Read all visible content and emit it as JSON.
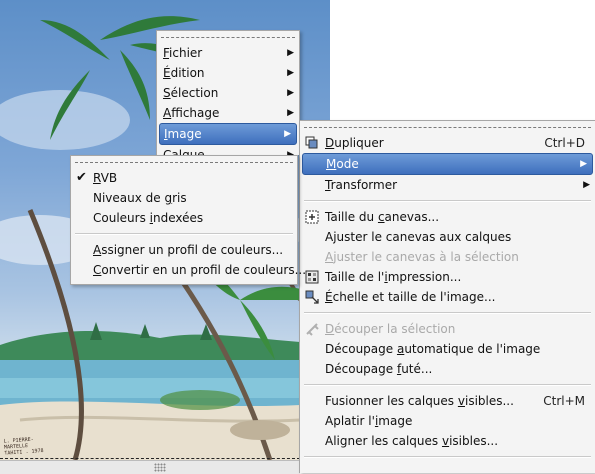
{
  "canvas": {
    "signature_lines": [
      "L. PIERRE-MARTELLE",
      "TAHITI . 1978"
    ]
  },
  "main_menu": {
    "items": [
      {
        "pre": "",
        "mn": "F",
        "post": "ichier",
        "name": "fichier"
      },
      {
        "pre": "",
        "mn": "É",
        "post": "dition",
        "name": "edition"
      },
      {
        "pre": "",
        "mn": "S",
        "post": "élection",
        "name": "selection"
      },
      {
        "pre": "",
        "mn": "A",
        "post": "ffichage",
        "name": "affichage"
      },
      {
        "pre": "",
        "mn": "I",
        "post": "mage",
        "name": "image"
      },
      {
        "pre": "",
        "mn": "C",
        "post": "alque",
        "name": "calque"
      }
    ],
    "active": "Image"
  },
  "image_menu": {
    "dupliquer": {
      "pre": "",
      "mn": "D",
      "post": "upliquer",
      "accel": "Ctrl+D"
    },
    "mode": {
      "pre": "",
      "mn": "M",
      "post": "ode"
    },
    "transformer": {
      "pre": "",
      "mn": "T",
      "post": "ransformer"
    },
    "taille_canevas": {
      "pre": "Taille du ",
      "mn": "c",
      "post": "anevas..."
    },
    "ajuster_calques": {
      "pre": "Ajuster le canevas aux calques",
      "mn": "",
      "post": ""
    },
    "ajuster_selection": {
      "pre": "",
      "mn": "A",
      "post": "juster le canevas à la sélection"
    },
    "taille_impression": {
      "pre": "Taille de l'",
      "mn": "i",
      "post": "mpression..."
    },
    "echelle": {
      "pre": "",
      "mn": "É",
      "post": "chelle et taille de l'image..."
    },
    "decouper_selection": {
      "pre": "",
      "mn": "D",
      "post": "écouper la sélection"
    },
    "decoupage_auto": {
      "pre": "Découpage ",
      "mn": "a",
      "post": "utomatique de l'image"
    },
    "decoupage_fute": {
      "pre": "Découpage ",
      "mn": "f",
      "post": "uté..."
    },
    "fusionner": {
      "pre": "Fusionner les calques ",
      "mn": "v",
      "post": "isibles...",
      "accel": "Ctrl+M"
    },
    "aplatir": {
      "pre": "Aplatir l'",
      "mn": "i",
      "post": "mage"
    },
    "aligner": {
      "pre": "Aligner les calques ",
      "mn": "v",
      "post": "isibles..."
    }
  },
  "mode_menu": {
    "rvb": {
      "pre": "",
      "mn": "R",
      "post": "VB",
      "checked": true
    },
    "niveaux_gris": {
      "pre": "Niveaux de ",
      "mn": "g",
      "post": "ris"
    },
    "couleurs_indexees": {
      "pre": "Couleurs ",
      "mn": "i",
      "post": "ndexées"
    },
    "assigner": {
      "pre": "",
      "mn": "A",
      "post": "ssigner un profil de couleurs..."
    },
    "convertir": {
      "pre": "",
      "mn": "C",
      "post": "onvertir en un profil de couleurs..."
    }
  },
  "icons": {
    "check": "✔",
    "submenu_arrow": "▶"
  }
}
